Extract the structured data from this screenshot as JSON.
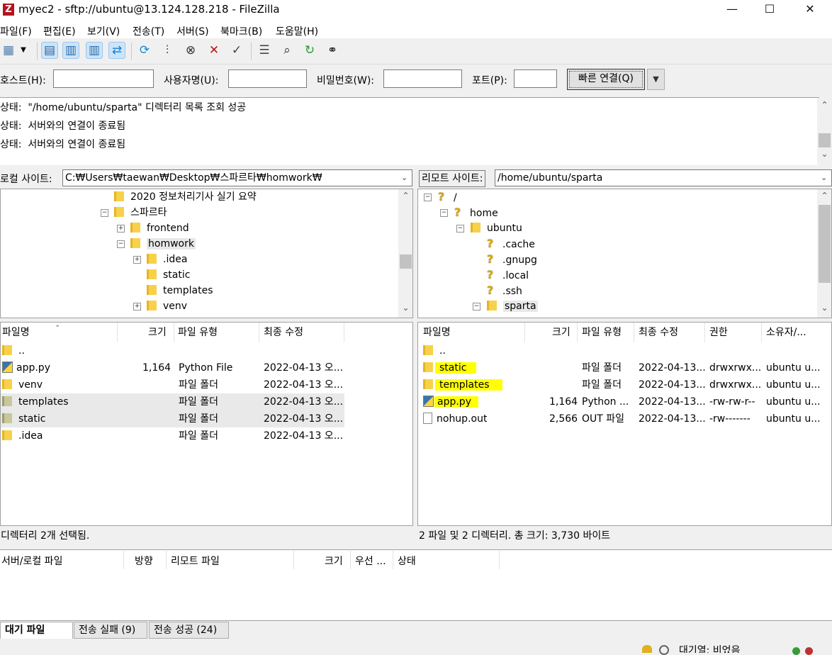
{
  "window": {
    "title": "myec2 - sftp://ubuntu@13.124.128.218 - FileZilla",
    "app_icon_glyph": "Z",
    "minimize": "—",
    "maximize": "☐",
    "close": "✕"
  },
  "menu": [
    "파일(F)",
    "편집(E)",
    "보기(V)",
    "전송(T)",
    "서버(S)",
    "북마크(B)",
    "도움말(H)"
  ],
  "toolbar": {
    "icons": [
      "site-manager-icon",
      "dropdown-arrow-icon",
      "toggle-message-log-icon",
      "toggle-local-tree-icon",
      "toggle-remote-tree-icon",
      "toggle-queue-icon",
      "refresh-icon",
      "process-queue-icon",
      "cancel-icon",
      "disconnect-icon",
      "reconnect-icon",
      "directory-filter-icon",
      "compare-icon",
      "sync-browse-icon",
      "search-icon"
    ]
  },
  "quickconnect": {
    "host_label": "호스트(H):",
    "user_label": "사용자명(U):",
    "pass_label": "비밀번호(W):",
    "port_label": "포트(P):",
    "host_value": "",
    "user_value": "",
    "pass_value": "",
    "port_value": "",
    "connect_label": "빠른 연결(Q)",
    "dropdown": "▼"
  },
  "log": [
    {
      "label": "상태:",
      "text": "\"/home/ubuntu/sparta\" 디렉터리 목록 조회 성공"
    },
    {
      "label": "상태:",
      "text": "서버와의 연결이 종료됨"
    },
    {
      "label": "상태:",
      "text": "서버와의 연결이 종료됨"
    }
  ],
  "local": {
    "site_label": "로컬 사이트:",
    "path": "C:₩Users₩taewan₩Desktop₩스파르타₩homwork₩",
    "tree": [
      "2020 정보처리기사 실기 요약",
      "스파르타",
      "frontend",
      "homwork",
      ".idea",
      "static",
      "templates",
      "venv"
    ],
    "headers": {
      "name": "파일명",
      "size": "크기",
      "type": "파일 유형",
      "modified": "최종 수정"
    },
    "files": [
      {
        "name": "..",
        "size": "",
        "type": "",
        "modified": ""
      },
      {
        "name": "app.py",
        "size": "1,164",
        "type": "Python File",
        "modified": "2022-04-13 오..."
      },
      {
        "name": "venv",
        "size": "",
        "type": "파일 폴더",
        "modified": "2022-04-13 오..."
      },
      {
        "name": "templates",
        "size": "",
        "type": "파일 폴더",
        "modified": "2022-04-13 오..."
      },
      {
        "name": "static",
        "size": "",
        "type": "파일 폴더",
        "modified": "2022-04-13 오..."
      },
      {
        "name": ".idea",
        "size": "",
        "type": "파일 폴더",
        "modified": "2022-04-13 오..."
      }
    ],
    "status": "디렉터리 2개 선택됨."
  },
  "remote": {
    "site_label": "리모트 사이트:",
    "path": "/home/ubuntu/sparta",
    "tree": [
      "/",
      "home",
      "ubuntu",
      ".cache",
      ".gnupg",
      ".local",
      ".ssh",
      "sparta"
    ],
    "headers": {
      "name": "파일명",
      "size": "크기",
      "type": "파일 유형",
      "modified": "최종 수정",
      "perms": "권한",
      "owner": "소유자/..."
    },
    "files": [
      {
        "name": "..",
        "size": "",
        "type": "",
        "modified": "",
        "perms": "",
        "owner": ""
      },
      {
        "name": "static",
        "size": "",
        "type": "파일 폴더",
        "modified": "2022-04-13...",
        "perms": "drwxrwx...",
        "owner": "ubuntu u..."
      },
      {
        "name": "templates",
        "size": "",
        "type": "파일 폴더",
        "modified": "2022-04-13...",
        "perms": "drwxrwx...",
        "owner": "ubuntu u..."
      },
      {
        "name": "app.py",
        "size": "1,164",
        "type": "Python ...",
        "modified": "2022-04-13...",
        "perms": "-rw-rw-r--",
        "owner": "ubuntu u..."
      },
      {
        "name": "nohup.out",
        "size": "2,566",
        "type": "OUT 파일",
        "modified": "2022-04-13...",
        "perms": "-rw-------",
        "owner": "ubuntu u..."
      }
    ],
    "status": "2 파일 및 2 디렉터리. 총 크기: 3,730 바이트"
  },
  "queue": {
    "headers": {
      "server_local": "서버/로컬 파일",
      "direction": "방향",
      "remote": "리모트 파일",
      "size": "크기",
      "priority": "우선 ...",
      "status": "상태"
    },
    "tabs": [
      "대기 파일",
      "전송 실패 (9)",
      "전송 성공 (24)"
    ],
    "status_text": "대기열: 비었음"
  },
  "colors": {
    "highlight": "#ffff00",
    "folder": "#f7d14a",
    "selection": "#cce4f7"
  }
}
